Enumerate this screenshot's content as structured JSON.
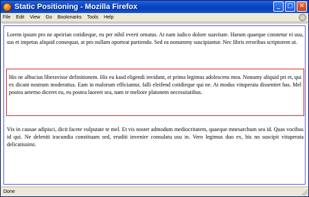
{
  "window": {
    "title": "Static Positioning - Mozilla Firefox"
  },
  "menubar": {
    "items": [
      "File",
      "Edit",
      "View",
      "Go",
      "Bookmarks",
      "Tools",
      "Help"
    ]
  },
  "icons": {
    "app": "firefox-icon",
    "minimize": "minimize-icon",
    "maximize": "maximize-icon",
    "close": "close-icon",
    "throbber": "throbber-icon",
    "grip": "resize-grip-icon"
  },
  "content": {
    "paragraphs": [
      "Lorem ipsum pro ne apeirian cotidieque, eu per nihil everti ornatus. At nam iudico dolore suavitate. Harum quaeque constetur ei usu, sus et impetus aliquid consequat, at pro nullam oporteat partiendo. Sed ea nonummy suscipiantur. Nec libris erroribus scriptorem ut.",
      "His ne albucius liberavisse definitionem. His eu kasd eligendi invidunt, et prima legimus adolescens mea. Nonumy aliquid pri et, qui ex dicant nostrum moderatius. Eam in malorum efficiantur, falli eleifend cotidieque qui ne. At modus vituperata dissentiet has. Mel postea aeterno diceret eu, eu postea laoreet sea, nam te meliore platonem necessitatibus.",
      "Vix in causae adipisci, dicit facete vulputate te mel. Et vis noster admodum mediocritatem, quaeque mnesarchum sea id. Quas vocibus id qui. Ne deleniti iracundia constituam sed, eruditi invenire consulatu usu in. Vero legimus duo ex, his no suscipit vituperata delicatissimi."
    ]
  },
  "statusbar": {
    "text": "Done"
  },
  "colors": {
    "outer_border": "#5b5bdd",
    "middle_border": "#c8332f",
    "titlebar": "#0a46c8"
  }
}
